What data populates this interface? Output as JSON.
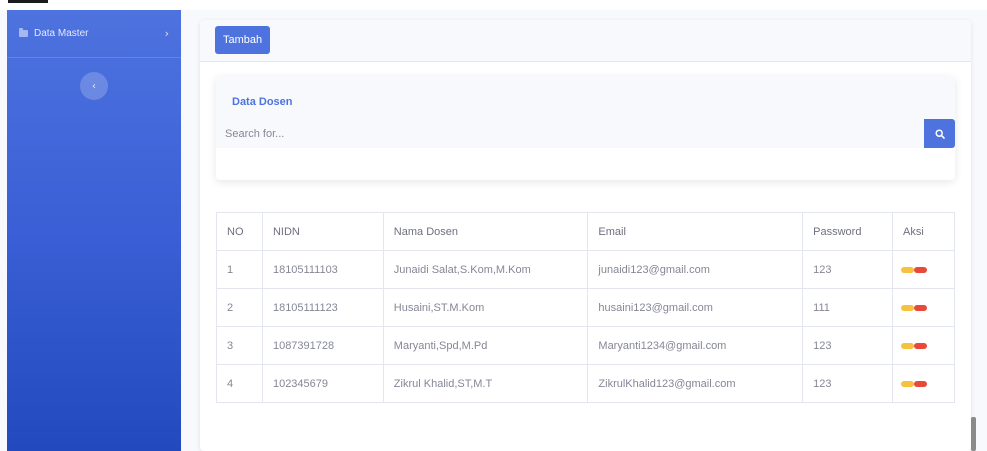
{
  "sidebar": {
    "menu_label": "Data Master",
    "chevron_glyph": "›",
    "toggle_glyph": "‹"
  },
  "toolbar": {
    "add_label": "Tambah"
  },
  "panel": {
    "title": "Data Dosen",
    "search_placeholder": "Search for..."
  },
  "table": {
    "headers": {
      "no": "NO",
      "nidn": "NIDN",
      "nama": "Nama Dosen",
      "email": "Email",
      "password": "Password",
      "aksi": "Aksi"
    },
    "rows": [
      {
        "no": "1",
        "nidn": "18105111103",
        "nama": "Junaidi Salat,S.Kom,M.Kom",
        "email": "junaidi123@gmail.com",
        "password": "123"
      },
      {
        "no": "2",
        "nidn": "18105111123",
        "nama": "Husaini,ST.M.Kom",
        "email": "husaini123@gmail.com",
        "password": "111"
      },
      {
        "no": "3",
        "nidn": "1087391728",
        "nama": "Maryanti,Spd,M.Pd",
        "email": "Maryanti1234@gmail.com",
        "password": "123"
      },
      {
        "no": "4",
        "nidn": "102345679",
        "nama": "Zikrul Khalid,ST,M.T",
        "email": "ZikrulKhalid123@gmail.com",
        "password": "123"
      }
    ]
  },
  "colors": {
    "primary": "#4e73df",
    "edit_button": "#f6c23e",
    "delete_button": "#e74a3b"
  },
  "icons": {
    "menu": "folder-icon",
    "search": "search-icon",
    "edit": "edit-icon",
    "delete": "delete-icon"
  }
}
